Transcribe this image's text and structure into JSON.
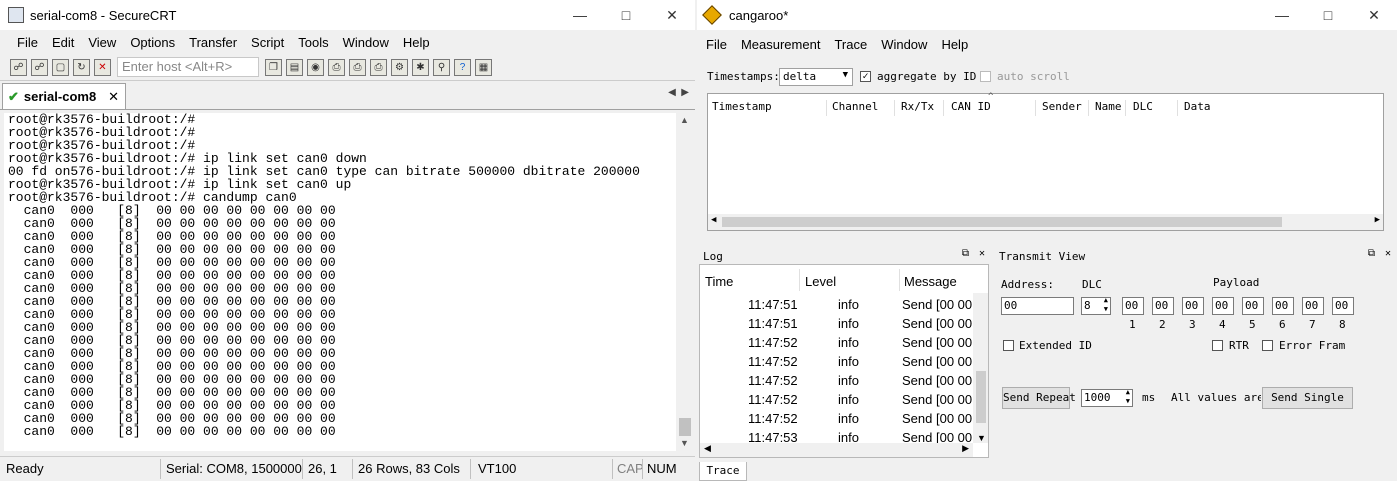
{
  "securecrt": {
    "title": "serial-com8 - SecureCRT",
    "menu": [
      "File",
      "Edit",
      "View",
      "Options",
      "Transfer",
      "Script",
      "Tools",
      "Window",
      "Help"
    ],
    "host_placeholder": "Enter host <Alt+R>",
    "tab_label": "serial-com8",
    "terminal_lines": [
      "root@rk3576-buildroot:/#",
      "root@rk3576-buildroot:/#",
      "root@rk3576-buildroot:/#",
      "root@rk3576-buildroot:/# ip link set can0 down",
      "00 fd on576-buildroot:/# ip link set can0 type can bitrate 500000 dbitrate 200000",
      "root@rk3576-buildroot:/# ip link set can0 up",
      "root@rk3576-buildroot:/# candump can0",
      "  can0  000   [8]  00 00 00 00 00 00 00 00",
      "  can0  000   [8]  00 00 00 00 00 00 00 00",
      "  can0  000   [8]  00 00 00 00 00 00 00 00",
      "  can0  000   [8]  00 00 00 00 00 00 00 00",
      "  can0  000   [8]  00 00 00 00 00 00 00 00",
      "  can0  000   [8]  00 00 00 00 00 00 00 00",
      "  can0  000   [8]  00 00 00 00 00 00 00 00",
      "  can0  000   [8]  00 00 00 00 00 00 00 00",
      "  can0  000   [8]  00 00 00 00 00 00 00 00",
      "  can0  000   [8]  00 00 00 00 00 00 00 00",
      "  can0  000   [8]  00 00 00 00 00 00 00 00",
      "  can0  000   [8]  00 00 00 00 00 00 00 00",
      "  can0  000   [8]  00 00 00 00 00 00 00 00",
      "  can0  000   [8]  00 00 00 00 00 00 00 00",
      "  can0  000   [8]  00 00 00 00 00 00 00 00",
      "  can0  000   [8]  00 00 00 00 00 00 00 00",
      "  can0  000   [8]  00 00 00 00 00 00 00 00",
      "  can0  000   [8]  00 00 00 00 00 00 00 00"
    ],
    "status": {
      "ready": "Ready",
      "serial": "Serial: COM8, 1500000",
      "cursor": "26,   1",
      "size": "26 Rows, 83 Cols",
      "term": "VT100",
      "cap": "CAP",
      "num": "NUM"
    }
  },
  "cangaroo": {
    "title": "cangaroo*",
    "menu": [
      "File",
      "Measurement",
      "Trace",
      "Window",
      "Help"
    ],
    "timestamps_label": "Timestamps:",
    "timestamps_value": "delta",
    "aggregate_label": "aggregate by ID",
    "autoscroll_label": "auto scroll",
    "trace_columns": [
      "Timestamp",
      "Channel",
      "Rx/Tx",
      "CAN ID",
      "Sender",
      "Name",
      "DLC",
      "Data"
    ],
    "log": {
      "title": "Log",
      "columns": [
        "Time",
        "Level",
        "Message"
      ],
      "rows": [
        {
          "time": "11:47:51",
          "level": "info",
          "message": "Send [00 00"
        },
        {
          "time": "11:47:51",
          "level": "info",
          "message": "Send [00 00"
        },
        {
          "time": "11:47:52",
          "level": "info",
          "message": "Send [00 00"
        },
        {
          "time": "11:47:52",
          "level": "info",
          "message": "Send [00 00"
        },
        {
          "time": "11:47:52",
          "level": "info",
          "message": "Send [00 00"
        },
        {
          "time": "11:47:52",
          "level": "info",
          "message": "Send [00 00"
        },
        {
          "time": "11:47:52",
          "level": "info",
          "message": "Send [00 00"
        },
        {
          "time": "11:47:53",
          "level": "info",
          "message": "Send [00 00"
        }
      ]
    },
    "transmit": {
      "title": "Transmit View",
      "address_label": "Address:",
      "dlc_label": "DLC",
      "payload_label": "Payload",
      "address_value": "00",
      "dlc_value": "8",
      "bytes": [
        "00",
        "00",
        "00",
        "00",
        "00",
        "00",
        "00",
        "00"
      ],
      "byte_indices": [
        "1",
        "2",
        "3",
        "4",
        "5",
        "6",
        "7",
        "8"
      ],
      "extended_label": "Extended ID",
      "rtr_label": "RTR",
      "error_label": "Error Fram",
      "send_repeat": "Send Repeat",
      "interval": "1000",
      "ms": "ms",
      "all_values": "All values are",
      "send_single": "Send Single"
    },
    "bottom_tab": "Trace"
  }
}
